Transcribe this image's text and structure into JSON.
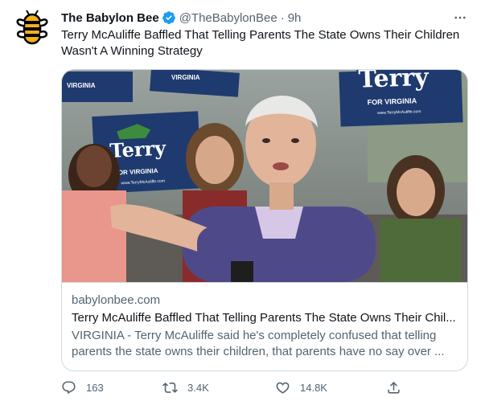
{
  "tweet": {
    "author_name": "The Babylon Bee",
    "handle": "@TheBabylonBee",
    "separator": "·",
    "time": "9h",
    "text": "Terry McAuliffe Baffled That Telling Parents The State Owns Their Children Wasn't A Winning Strategy"
  },
  "card": {
    "domain": "babylonbee.com",
    "title": "Terry McAuliffe Baffled That Telling Parents The State Owns Their Chil...",
    "description": "VIRGINIA - Terry McAuliffe said he's completely confused that telling parents the state owns their children, that parents have no say over ...",
    "image_signs": {
      "sign_main": "Terry",
      "sign_sub": "FOR VIRGINIA",
      "sign_url": "www.TerryMcAuliffe.com",
      "sign_left_top": "VIRGINIA",
      "sign_center_top": "VIRGINIA"
    }
  },
  "actions": {
    "reply_count": "163",
    "retweet_count": "3.4K",
    "like_count": "14.8K"
  },
  "colors": {
    "verified": "#1d9bf0",
    "secondary_text": "#536471",
    "sign_blue": "#1f3a6e",
    "sign_green": "#3d8b3d"
  },
  "icons": [
    "babylon-bee-logo",
    "verified-badge-icon",
    "more-icon",
    "reply-icon",
    "retweet-icon",
    "like-icon",
    "share-icon"
  ]
}
